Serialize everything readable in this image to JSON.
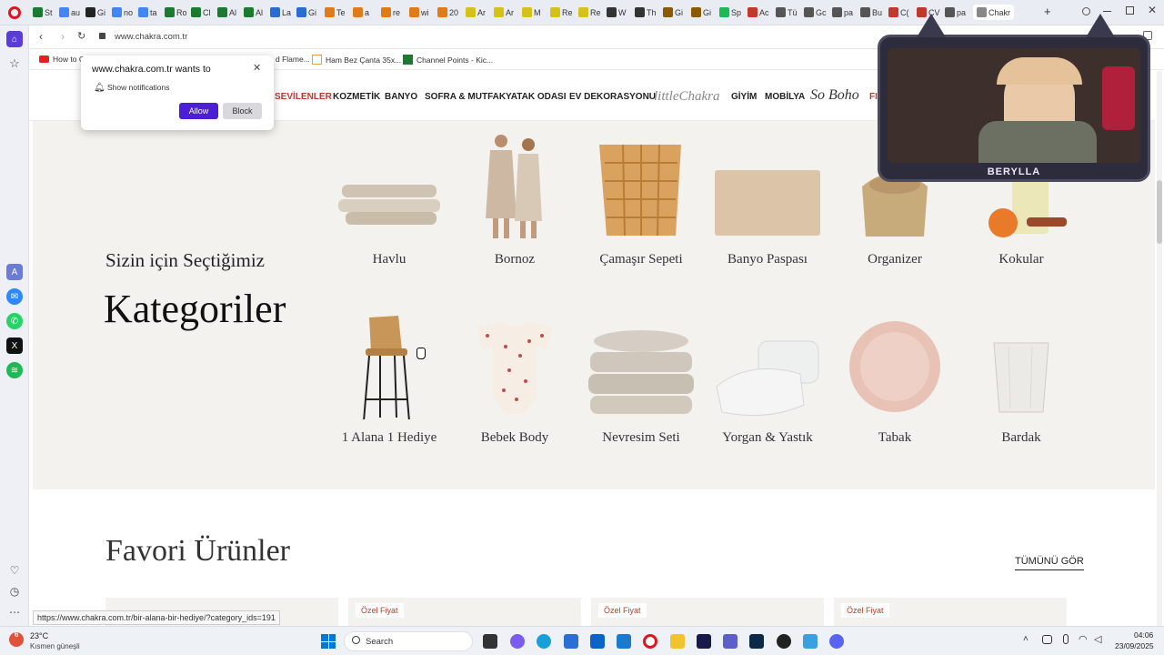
{
  "browser": {
    "tabs": [
      {
        "label": "St",
        "color": "#1b7a2f"
      },
      {
        "label": "au",
        "color": "#4285f4"
      },
      {
        "label": "Gi",
        "color": "#222222"
      },
      {
        "label": "no",
        "color": "#4285f4"
      },
      {
        "label": "ta",
        "color": "#4285f4"
      },
      {
        "label": "Ro",
        "color": "#1b7a2f"
      },
      {
        "label": "Cl",
        "color": "#1b7a2f"
      },
      {
        "label": "Al",
        "color": "#1b7a2f"
      },
      {
        "label": "Al",
        "color": "#1b7a2f"
      },
      {
        "label": "La",
        "color": "#2b6cd4"
      },
      {
        "label": "Gi",
        "color": "#2b6cd4"
      },
      {
        "label": "Te",
        "color": "#e07b1a"
      },
      {
        "label": "a",
        "color": "#e07b1a"
      },
      {
        "label": "re",
        "color": "#e07b1a"
      },
      {
        "label": "wi",
        "color": "#e07b1a"
      },
      {
        "label": "20",
        "color": "#e07b1a"
      },
      {
        "label": "Ar",
        "color": "#d4c21a"
      },
      {
        "label": "Ar",
        "color": "#d4c21a"
      },
      {
        "label": "M",
        "color": "#d4c21a"
      },
      {
        "label": "Re",
        "color": "#d4c21a"
      },
      {
        "label": "Re",
        "color": "#d4c21a"
      },
      {
        "label": "W",
        "color": "#333333"
      },
      {
        "label": "Th",
        "color": "#333333"
      },
      {
        "label": "Gi",
        "color": "#8a5a00"
      },
      {
        "label": "Gi",
        "color": "#8a5a00"
      },
      {
        "label": "Sp",
        "color": "#1db954"
      },
      {
        "label": "Ac",
        "color": "#c0392b"
      },
      {
        "label": "Tü",
        "color": "#555555"
      },
      {
        "label": "Gc",
        "color": "#555555"
      },
      {
        "label": "pa",
        "color": "#555555"
      },
      {
        "label": "Bu",
        "color": "#555555"
      },
      {
        "label": "C(",
        "color": "#c0392b"
      },
      {
        "label": "CV",
        "color": "#c0392b"
      },
      {
        "label": "pa",
        "color": "#555555"
      },
      {
        "label": "Chakr",
        "color": "#888888",
        "active": true
      }
    ],
    "new_tab_label": "+",
    "address": "www.chakra.com.tr",
    "bookmarks": [
      {
        "label": "How to C",
        "color": "#e62117"
      },
      {
        "label": "d Flame...",
        "color": "#888888"
      },
      {
        "label": "Ham Bez Çanta 35x...",
        "color": "#d9a441"
      },
      {
        "label": "Channel Points - Kic...",
        "color": "#1b7a2f"
      }
    ],
    "status_url": "https://www.chakra.com.tr/bir-alana-bir-hediye/?category_ids=191"
  },
  "notification_popup": {
    "title": "www.chakra.com.tr wants to",
    "permission": "Show notifications",
    "allow_label": "Allow",
    "block_label": "Block"
  },
  "site_nav": {
    "items": [
      {
        "label": "SEVİLENLER",
        "color": "#c0392b"
      },
      {
        "label": "KOZMETİK",
        "color": "#222222"
      },
      {
        "label": "BANYO",
        "color": "#222222"
      },
      {
        "label": "SOFRA & MUTFAK",
        "color": "#222222"
      },
      {
        "label": "YATAK ODASI",
        "color": "#222222"
      },
      {
        "label": "EV DEKORASYONU",
        "color": "#222222"
      }
    ],
    "little_chakra_logo": "littleChakra",
    "items2": [
      {
        "label": "GİYİM"
      },
      {
        "label": "MOBİLYA"
      }
    ],
    "so_boho_logo": "So Boho",
    "cut_item": "FI"
  },
  "categories": {
    "heading_small": "Sizin için Seçtiğimiz",
    "heading_large": "Kategoriler",
    "items": [
      {
        "label": "Havlu",
        "icon": "towel-icon"
      },
      {
        "label": "Bornoz",
        "icon": "bathrobe-icon"
      },
      {
        "label": "Çamaşır Sepeti",
        "icon": "laundry-basket-icon"
      },
      {
        "label": "Banyo Paspası",
        "icon": "bath-mat-icon"
      },
      {
        "label": "Organizer",
        "icon": "organizer-icon"
      },
      {
        "label": "Kokular",
        "icon": "fragrance-icon"
      },
      {
        "label": "1 Alana 1 Hediye",
        "icon": "bar-stool-icon"
      },
      {
        "label": "Bebek Body",
        "icon": "baby-body-icon"
      },
      {
        "label": "Nevresim Seti",
        "icon": "duvet-set-icon"
      },
      {
        "label": "Yorgan & Yastık",
        "icon": "quilt-pillow-icon"
      },
      {
        "label": "Tabak",
        "icon": "plate-icon"
      },
      {
        "label": "Bardak",
        "icon": "glass-icon"
      }
    ]
  },
  "favorites": {
    "title": "Favori Ürünler",
    "see_all": "TÜMÜNÜ GÖR",
    "badges": [
      "Özel Fiyat",
      "Özel Fiyat",
      "Özel Fiyat"
    ]
  },
  "webcam": {
    "name": "BERYLLA"
  },
  "taskbar": {
    "weather_temp": "23°C",
    "weather_desc": "Kısmen güneşli",
    "weather_badge": "6",
    "search_placeholder": "Search",
    "time": "04:06",
    "date": "23/09/2025"
  }
}
